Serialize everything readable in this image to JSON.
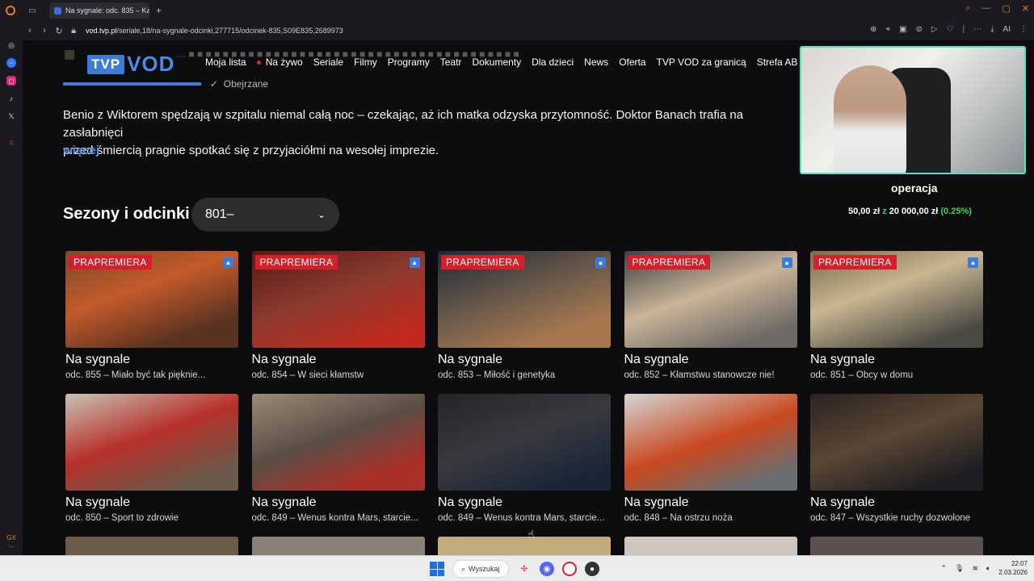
{
  "browser": {
    "tab_title": "Na sygnale: odc. 835 – Ka",
    "new_tab": "+",
    "url_domain": "vod.tvp.pl",
    "url_path": "/seriale,18/na-sygnale-odcinki,277715/odcinek-835,S09E835,2689973",
    "ai_label": "AI"
  },
  "header": {
    "logo_tvp": "TVP",
    "logo_vod": "VOD",
    "menu": [
      "Moja lista",
      "Na żywo",
      "Seriale",
      "Filmy",
      "Programy",
      "Teatr",
      "Dokumenty",
      "Dla dzieci",
      "News",
      "Oferta",
      "TVP VOD za granicą",
      "Strefa AB"
    ],
    "ghost_text": "… ■ ■ ■ ■ ■ ■ ■ ■ ■ ■ ■ ■ ■ ■ ■ ■ ■ ■ ■ ■ ■ ■ ■ ■ ■ ■ ■ ■ ■ ■ ■ ■ ■ ■ ■ ■ ■ ■ ■",
    "watched": "Obejrzane"
  },
  "episode": {
    "description_line1": "Benio z Wiktorem spędzają w szpitalu niemal całą noc – czekając, aż ich matka odzyska przytomność. Doktor Banach trafia na zasłabnięci",
    "description_line2": "przed śmiercią pragnie spotkać się z przyjaciółmi na wesołej imprezie.",
    "more": "więcej"
  },
  "seasons": {
    "title": "Sezony i odcinki",
    "selected": "801–"
  },
  "cards": [
    {
      "badge": "PRAPREMIERA",
      "title": "Na sygnale",
      "subtitle": "odc. 855 – Miało być tak pięknie...",
      "bg": "linear-gradient(160deg,#7a4a2a,#c45a2a 40%,#5a3320 80%)"
    },
    {
      "badge": "PRAPREMIERA",
      "title": "Na sygnale",
      "subtitle": "odc. 854 – W sieci kłamstw",
      "bg": "linear-gradient(160deg,#5a1a14,#8a3a2e 45%,#c02a1e 85%)"
    },
    {
      "badge": "PRAPREMIERA",
      "title": "Na sygnale",
      "subtitle": "odc. 853 – Miłość i genetyka",
      "bg": "linear-gradient(160deg,#1e2a38,#6a5a4a 45%,#a7784e 80%)"
    },
    {
      "badge": "PRAPREMIERA",
      "title": "Na sygnale",
      "subtitle": "odc. 852 – Kłamstwu stanowcze nie!",
      "bg": "linear-gradient(160deg,#3c4046,#c9b497 45%,#6e6a66 85%)"
    },
    {
      "badge": "PRAPREMIERA",
      "title": "Na sygnale",
      "subtitle": "odc. 851 – Obcy w domu",
      "bg": "linear-gradient(160deg,#7a6a48,#c8b690 40%,#4a4a44 85%)"
    },
    {
      "badge": "",
      "title": "Na sygnale",
      "subtitle": "odc. 850 – Sport to zdrowie",
      "bg": "linear-gradient(160deg,#c9c3b6,#b6312a 45%,#6a5a4a 85%)"
    },
    {
      "badge": "",
      "title": "Na sygnale",
      "subtitle": "odc. 849 – Wenus kontra Mars, starcie...",
      "bg": "linear-gradient(160deg,#9a8a78,#5a4e44 45%,#a83028 80%)"
    },
    {
      "badge": "",
      "title": "Na sygnale",
      "subtitle": "odc. 849 – Wenus kontra Mars, starcie...",
      "bg": "linear-gradient(160deg,#222428,#3a3a3e 45%,#1a2538 85%)"
    },
    {
      "badge": "",
      "title": "Na sygnale",
      "subtitle": "odc. 848 – Na ostrzu noża",
      "bg": "linear-gradient(160deg,#d4d6d6,#c8481e 50%,#6a6e70 85%)"
    },
    {
      "badge": "",
      "title": "Na sygnale",
      "subtitle": "odc. 847 – Wszystkie ruchy dozwolone",
      "bg": "linear-gradient(160deg,#2a2420,#5a4634 45%,#1e1e22 85%)"
    }
  ],
  "row3_colors": [
    "#6e5a48",
    "#8a8276",
    "#c3ab7c",
    "#cdc7c0",
    "#5a5250"
  ],
  "stream": {
    "label": "operacja",
    "donate_current": "50,00 zł",
    "donate_sep": "z",
    "donate_goal": "20 000,00 zł",
    "donate_pct": "(0.25%)",
    "progress_fraction": 0.0025
  },
  "taskbar": {
    "search": "Wyszukaj",
    "time": "22:07",
    "date": "2.03.2026"
  }
}
